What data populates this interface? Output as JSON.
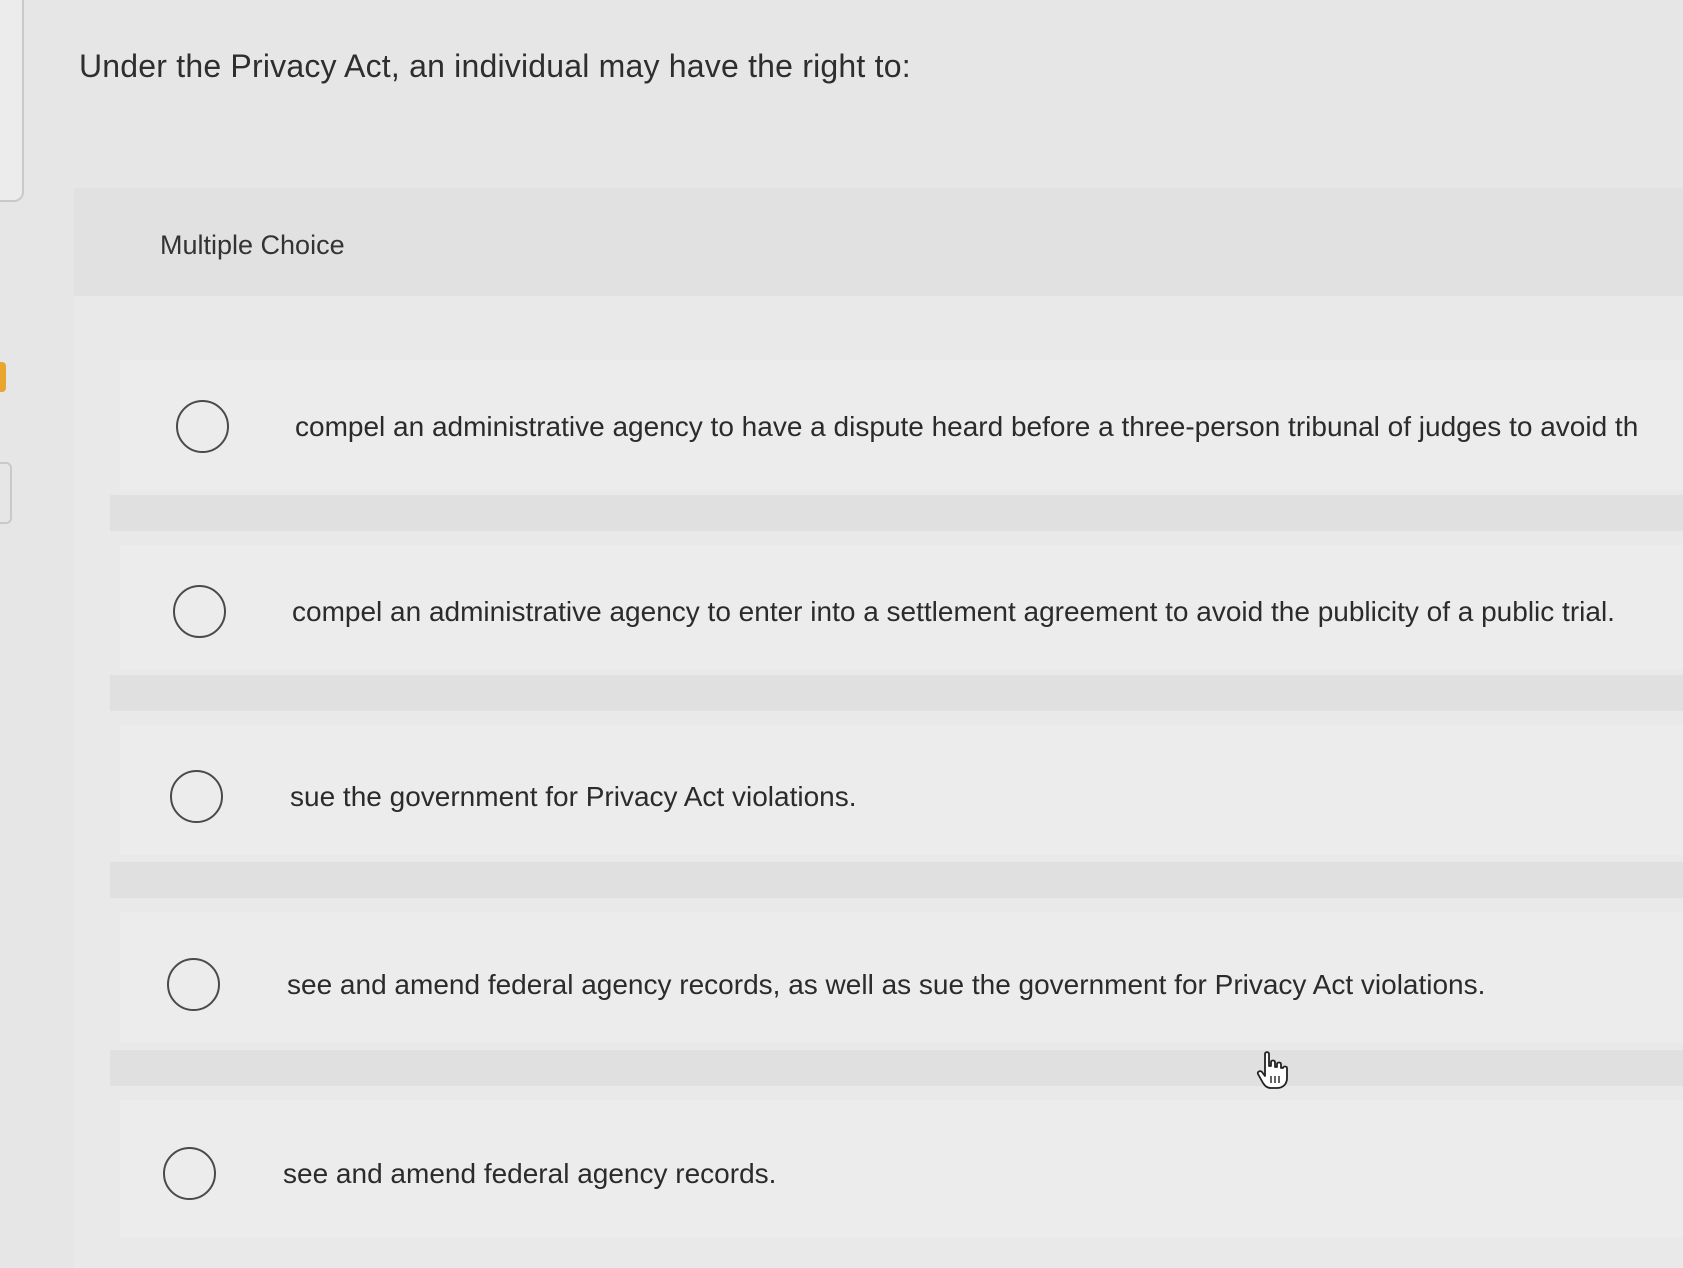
{
  "question": {
    "text": "Under the Privacy Act, an individual may have the right to:"
  },
  "multiple_choice": {
    "label": "Multiple Choice",
    "options": [
      {
        "text": "compel an administrative agency to have a dispute heard before a three-person tribunal of judges to avoid th"
      },
      {
        "text": "compel an administrative agency to enter into a settlement agreement to avoid the publicity of a public trial."
      },
      {
        "text": "sue the government for Privacy Act violations."
      },
      {
        "text": "see and amend federal agency records, as well as sue the government for Privacy Act violations."
      },
      {
        "text": "see and amend federal agency records."
      }
    ]
  },
  "icons": {
    "radio": "radio-button-icon",
    "cursor": "hand-pointer-cursor-icon"
  },
  "colors": {
    "background": "#e6e6e6",
    "text": "#2b2b2b",
    "radio_border": "#4a4a4a",
    "accent_edge": "#e8a530"
  }
}
